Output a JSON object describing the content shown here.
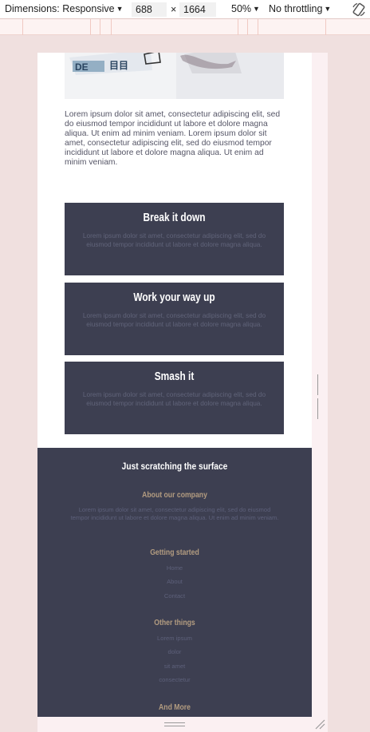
{
  "toolbar": {
    "dimensions_label": "Dimensions: Responsive",
    "width_value": "688",
    "times": "×",
    "height_value": "1664",
    "zoom": "50%",
    "throttling": "No throttling",
    "caret": "▼",
    "rotate_icon": "rotate-icon"
  },
  "content": {
    "paragraph": "Lorem ipsum dolor sit amet, consectetur adipiscing elit, sed do eiusmod tempor incididunt ut labore et dolore magna aliqua. Ut enim ad minim veniam. Lorem ipsum dolor sit amet, consectetur adipiscing elit, sed do eiusmod tempor incididunt ut labore et dolore magna aliqua. Ut enim ad minim veniam.",
    "cards": [
      {
        "title": "Break it down",
        "text": "Lorem ipsum dolor sit amet, consectetur adipiscing elit, sed do eiusmod tempor incididunt ut labore et dolore magna aliqua."
      },
      {
        "title": "Work your way up",
        "text": "Lorem ipsum dolor sit amet, consectetur adipiscing elit, sed do eiusmod tempor incididunt ut labore et dolore magna aliqua."
      },
      {
        "title": "Smash it",
        "text": "Lorem ipsum dolor sit amet, consectetur adipiscing elit, sed do eiusmod tempor incididunt ut labore et dolore magna aliqua."
      }
    ]
  },
  "footer": {
    "title": "Just scratching the surface",
    "about_heading": "About our company",
    "about_text": "Lorem ipsum dolor sit amet, consectetur adipiscing elit, sed do eiusmod tempor incididunt ut labore et dolore magna aliqua. Ut enim ad minim veniam.",
    "getting_started_heading": "Getting started",
    "getting_started_links": [
      "Home",
      "About",
      "Contact"
    ],
    "other_heading": "Other things",
    "other_links": [
      "Lorem ipsum",
      "dolor",
      "sit amet",
      "consectetur"
    ],
    "more_heading": "And More"
  },
  "colors": {
    "card_bg": "#3d3f51",
    "accent_gold": "#b39c80",
    "device_bg": "#f0e0df"
  }
}
